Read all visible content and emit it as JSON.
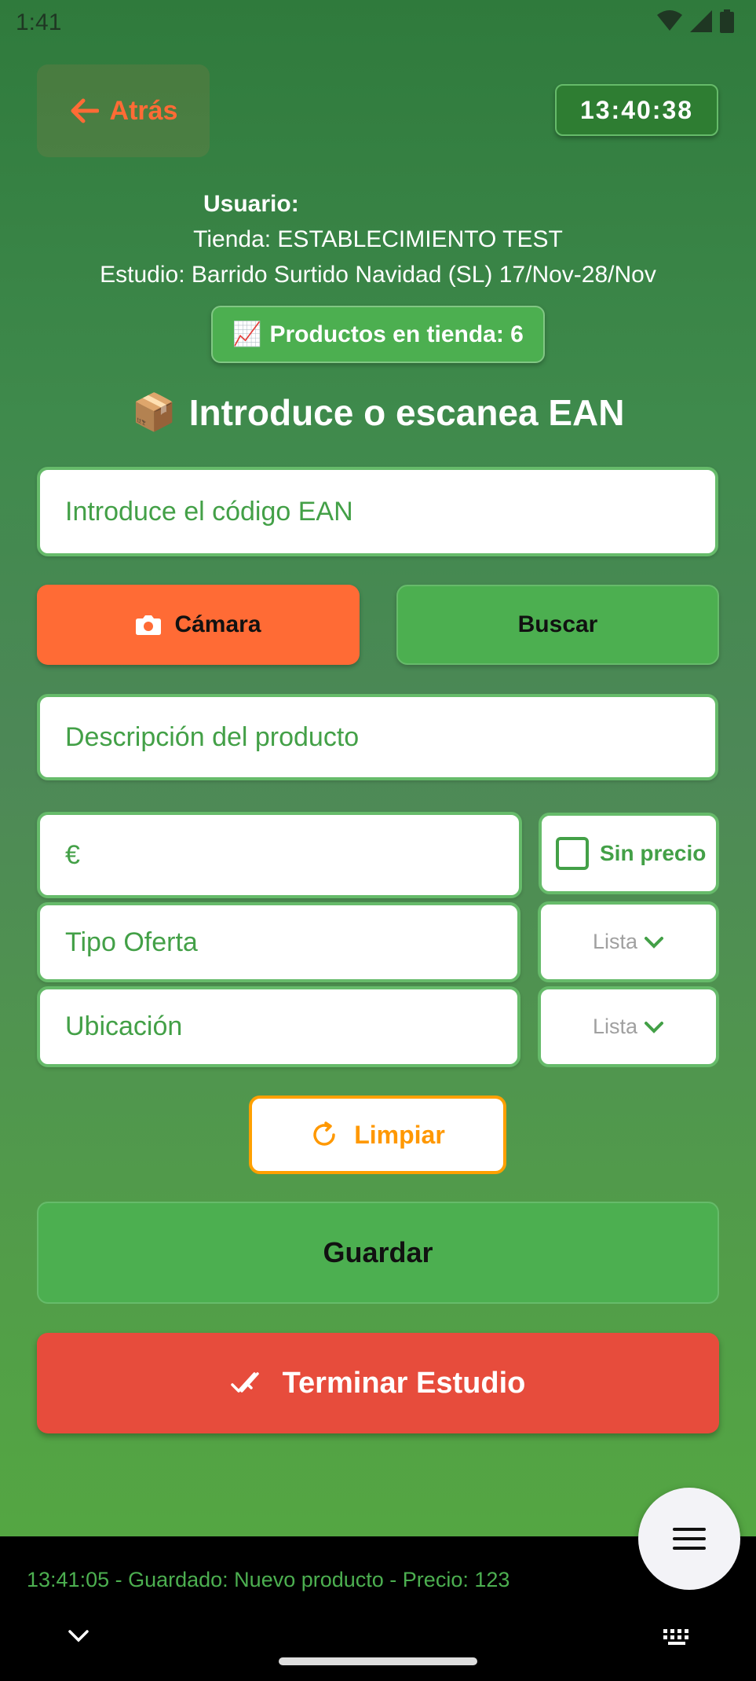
{
  "status_bar": {
    "time": "1:41",
    "icons": [
      "wifi-icon",
      "signal-icon",
      "battery-icon"
    ]
  },
  "header": {
    "back_label": "Atrás",
    "clock": "13:40:38"
  },
  "info": {
    "user_label": "Usuario:",
    "store": "Tienda: ESTABLECIMIENTO TEST",
    "study": "Estudio: Barrido Surtido Navidad (SL) 17/Nov-28/Nov"
  },
  "products_badge": {
    "emoji": "📈",
    "label": "Productos en tienda: 6"
  },
  "section": {
    "emoji": "📦",
    "title": "Introduce o escanea EAN"
  },
  "form": {
    "ean_placeholder": "Introduce el código EAN",
    "camera_label": "Cámara",
    "search_label": "Buscar",
    "description_placeholder": "Descripción del producto",
    "price_placeholder": "€",
    "no_price_label": "Sin precio",
    "offer_type_placeholder": "Tipo Oferta",
    "offer_list_label": "Lista",
    "location_placeholder": "Ubicación",
    "location_list_label": "Lista",
    "clear_label": "Limpiar",
    "save_label": "Guardar",
    "finish_label": "Terminar Estudio"
  },
  "log": {
    "message": "13:41:05 - Guardado: Nuevo producto - Precio: 123"
  },
  "colors": {
    "accent_orange": "#ff6b35",
    "primary_green": "#4caf50",
    "danger_red": "#e74c3c",
    "clear_amber": "#ff9800"
  }
}
